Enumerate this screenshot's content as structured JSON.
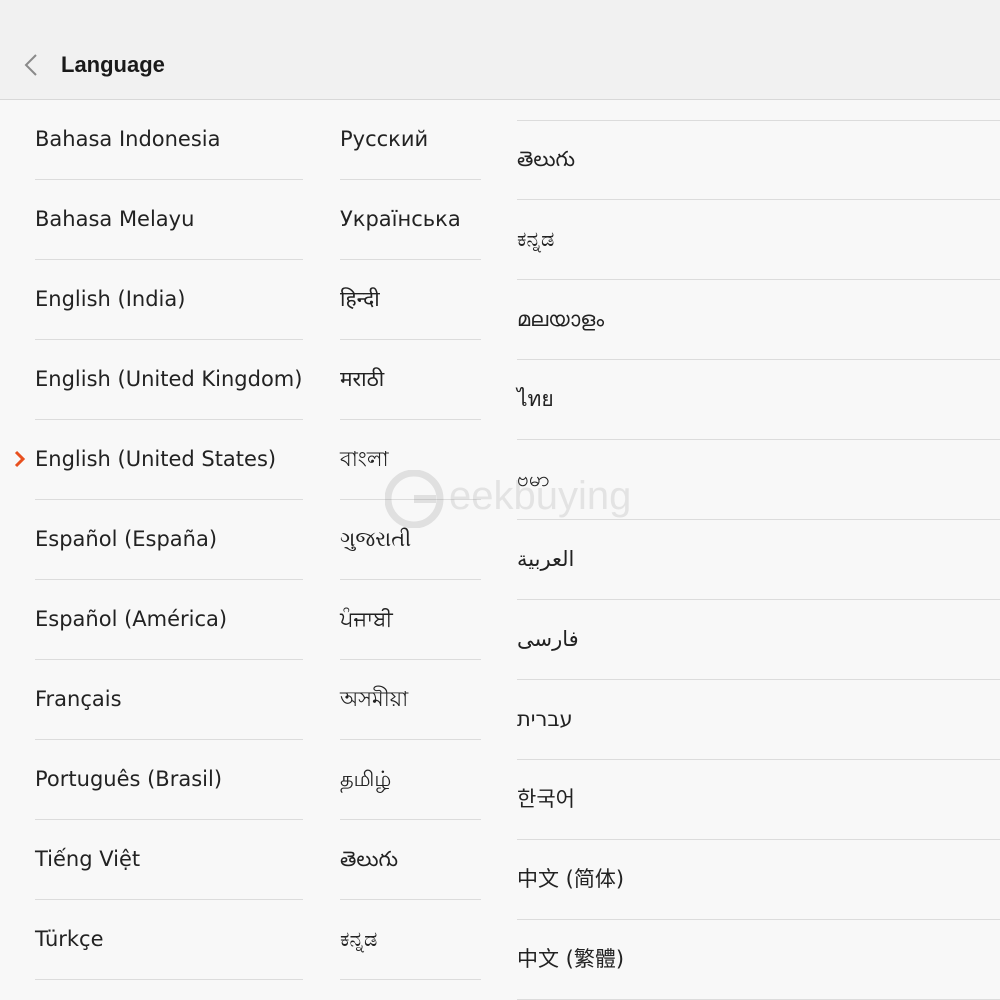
{
  "header": {
    "title": "Language",
    "back_icon": "chevron-left-icon"
  },
  "selected_language": "English (United States)",
  "accent_color": "#e8501e",
  "watermark": "eekbuying",
  "columns": [
    [
      "Bahasa Indonesia",
      "Bahasa Melayu",
      "English (India)",
      "English (United Kingdom)",
      "English (United States)",
      "Español (España)",
      "Español (América)",
      "Français",
      "Português (Brasil)",
      "Tiếng Việt",
      "Türkçe"
    ],
    [
      "Русский",
      "Українська",
      "हिन्दी",
      "मराठी",
      "বাংলা",
      "ગુજરાતી",
      "ਪੰਜਾਬੀ",
      "অসমীয়া",
      "தமிழ்",
      "తెలుగు",
      "ಕನ್ನಡ"
    ],
    [
      "తెలుగు",
      "ಕನ್ನಡ",
      "മലയാളം",
      "ไทย",
      "ဗမာ",
      "العربية",
      "فارسی",
      "עברית",
      "한국어",
      "中文 (简体)",
      "中文 (繁體)"
    ]
  ]
}
